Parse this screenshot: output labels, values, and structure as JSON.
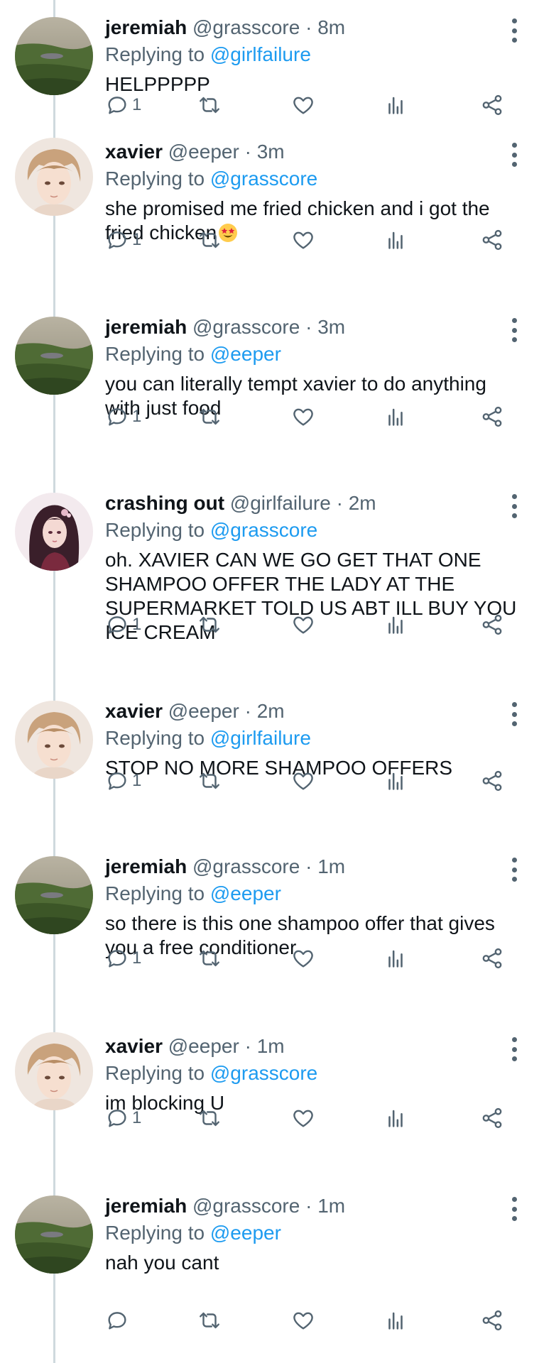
{
  "tweets": [
    {
      "name": "jeremiah",
      "handle": "@grasscore",
      "time": "8m",
      "reply_prefix": "Replying to",
      "reply_to": "@girlfailure",
      "text": "HELPPPPP",
      "reply_count": "1",
      "avatar": "grass"
    },
    {
      "name": "xavier",
      "handle": "@eeper",
      "time": "3m",
      "reply_prefix": "Replying to",
      "reply_to": "@grasscore",
      "text": "she promised me fried chicken and i got the fried chicken",
      "emoji": "star-struck-emoji",
      "reply_count": "1",
      "avatar": "anime-boy"
    },
    {
      "name": "jeremiah",
      "handle": "@grasscore",
      "time": "3m",
      "reply_prefix": "Replying to",
      "reply_to": "@eeper",
      "text": "you can literally tempt xavier to do anything with just food",
      "reply_count": "1",
      "avatar": "grass"
    },
    {
      "name": "crashing out",
      "handle": "@girlfailure",
      "time": "2m",
      "reply_prefix": "Replying to",
      "reply_to": "@grasscore",
      "text": "oh. XAVIER CAN WE GO GET THAT ONE SHAMPOO OFFER THE LADY AT THE SUPERMARKET TOLD US ABT ILL BUY YOU ICE CREAM",
      "reply_count": "1",
      "avatar": "anime-girl"
    },
    {
      "name": "xavier",
      "handle": "@eeper",
      "time": "2m",
      "reply_prefix": "Replying to",
      "reply_to": "@girlfailure",
      "text": "STOP NO MORE SHAMPOO OFFERS",
      "reply_count": "1",
      "avatar": "anime-boy"
    },
    {
      "name": "jeremiah",
      "handle": "@grasscore",
      "time": "1m",
      "reply_prefix": "Replying to",
      "reply_to": "@eeper",
      "text": "so there is this one shampoo offer that gives you a free conditioner",
      "reply_count": "1",
      "avatar": "grass"
    },
    {
      "name": "xavier",
      "handle": "@eeper",
      "time": "1m",
      "reply_prefix": "Replying to",
      "reply_to": "@grasscore",
      "text": "im blocking U",
      "reply_count": "1",
      "avatar": "anime-boy"
    },
    {
      "name": "jeremiah",
      "handle": "@grasscore",
      "time": "1m",
      "reply_prefix": "Replying to",
      "reply_to": "@eeper",
      "text": "nah you cant",
      "reply_count": "",
      "avatar": "grass"
    }
  ],
  "separator": "·",
  "icons": {
    "reply": "reply-icon",
    "retweet": "retweet-icon",
    "like": "like-icon",
    "views": "views-icon",
    "share": "share-icon",
    "more": "more-icon"
  },
  "colors": {
    "text": "#0f1419",
    "secondary": "#536471",
    "link": "#1d9bf0",
    "thread_line": "#cfd9de",
    "icon": "#536471"
  }
}
